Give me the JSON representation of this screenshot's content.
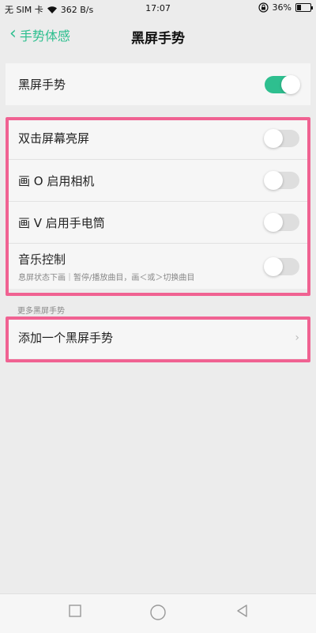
{
  "status_bar": {
    "carrier": "无 SIM 卡",
    "speed": "362 B/s",
    "time": "17:07",
    "battery": "36%",
    "battery_level": 0.36
  },
  "header": {
    "back_label": "手势体感",
    "title": "黑屏手势"
  },
  "main_toggle": {
    "label": "黑屏手势",
    "on": true
  },
  "gestures": [
    {
      "label": "双击屏幕亮屏",
      "on": false
    },
    {
      "label": "画 O 启用相机",
      "on": false
    },
    {
      "label": "画 V 启用手电筒",
      "on": false
    },
    {
      "label": "音乐控制",
      "subtitle": "息屏状态下画｜暂停/播放曲目，画＜或＞切换曲目",
      "on": false
    }
  ],
  "more_section": {
    "label": "更多黑屏手势",
    "add_label": "添加一个黑屏手势"
  },
  "colors": {
    "accent": "#2ebf8f",
    "highlight": "#f06292"
  }
}
